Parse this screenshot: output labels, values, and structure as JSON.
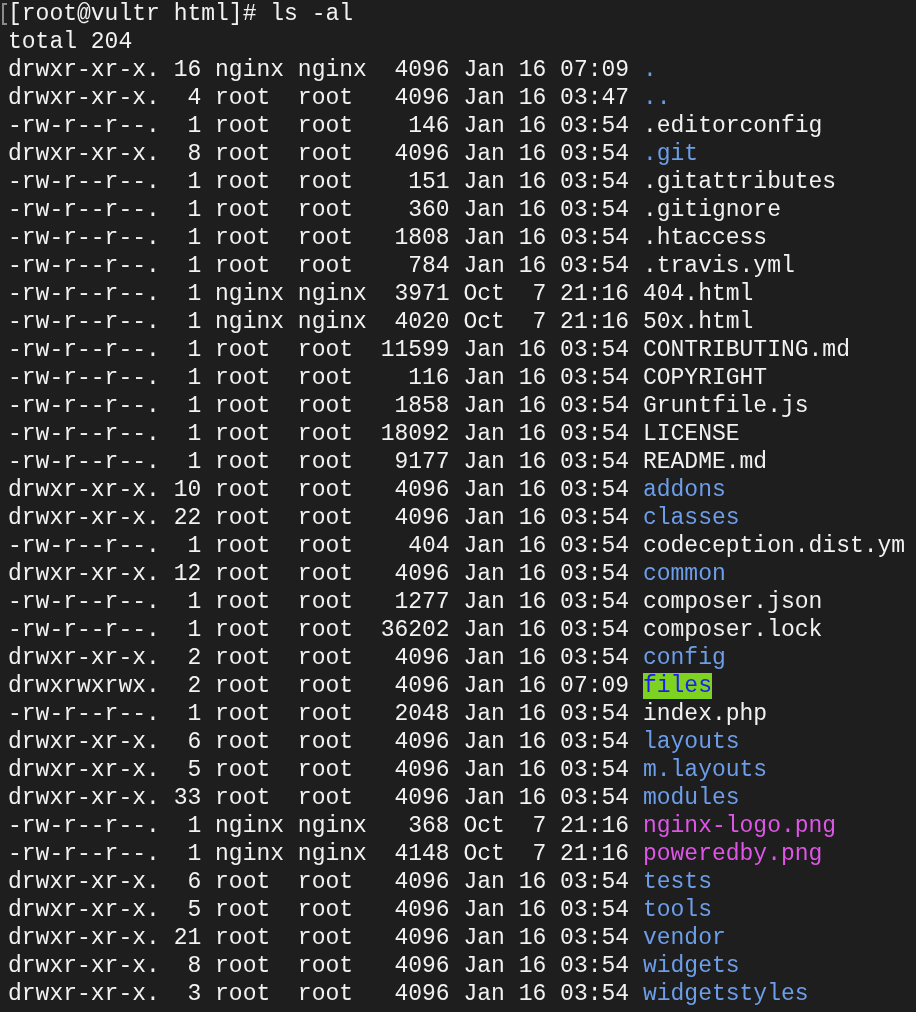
{
  "prompt": "[root@vultr html]# ls -al",
  "total": "total 204",
  "rows": [
    {
      "perms": "drwxr-xr-x.",
      "links": "16",
      "owner": "nginx",
      "group": "nginx",
      "size": "4096",
      "month": "Jan",
      "day": "16",
      "time": "07:09",
      "name": ".",
      "kind": "dir"
    },
    {
      "perms": "drwxr-xr-x.",
      "links": "4",
      "owner": "root",
      "group": "root",
      "size": "4096",
      "month": "Jan",
      "day": "16",
      "time": "03:47",
      "name": "..",
      "kind": "dir"
    },
    {
      "perms": "-rw-r--r--.",
      "links": "1",
      "owner": "root",
      "group": "root",
      "size": "146",
      "month": "Jan",
      "day": "16",
      "time": "03:54",
      "name": ".editorconfig",
      "kind": "file"
    },
    {
      "perms": "drwxr-xr-x.",
      "links": "8",
      "owner": "root",
      "group": "root",
      "size": "4096",
      "month": "Jan",
      "day": "16",
      "time": "03:54",
      "name": ".git",
      "kind": "dir"
    },
    {
      "perms": "-rw-r--r--.",
      "links": "1",
      "owner": "root",
      "group": "root",
      "size": "151",
      "month": "Jan",
      "day": "16",
      "time": "03:54",
      "name": ".gitattributes",
      "kind": "file"
    },
    {
      "perms": "-rw-r--r--.",
      "links": "1",
      "owner": "root",
      "group": "root",
      "size": "360",
      "month": "Jan",
      "day": "16",
      "time": "03:54",
      "name": ".gitignore",
      "kind": "file"
    },
    {
      "perms": "-rw-r--r--.",
      "links": "1",
      "owner": "root",
      "group": "root",
      "size": "1808",
      "month": "Jan",
      "day": "16",
      "time": "03:54",
      "name": ".htaccess",
      "kind": "file"
    },
    {
      "perms": "-rw-r--r--.",
      "links": "1",
      "owner": "root",
      "group": "root",
      "size": "784",
      "month": "Jan",
      "day": "16",
      "time": "03:54",
      "name": ".travis.yml",
      "kind": "file"
    },
    {
      "perms": "-rw-r--r--.",
      "links": "1",
      "owner": "nginx",
      "group": "nginx",
      "size": "3971",
      "month": "Oct",
      "day": "7",
      "time": "21:16",
      "name": "404.html",
      "kind": "file"
    },
    {
      "perms": "-rw-r--r--.",
      "links": "1",
      "owner": "nginx",
      "group": "nginx",
      "size": "4020",
      "month": "Oct",
      "day": "7",
      "time": "21:16",
      "name": "50x.html",
      "kind": "file"
    },
    {
      "perms": "-rw-r--r--.",
      "links": "1",
      "owner": "root",
      "group": "root",
      "size": "11599",
      "month": "Jan",
      "day": "16",
      "time": "03:54",
      "name": "CONTRIBUTING.md",
      "kind": "file"
    },
    {
      "perms": "-rw-r--r--.",
      "links": "1",
      "owner": "root",
      "group": "root",
      "size": "116",
      "month": "Jan",
      "day": "16",
      "time": "03:54",
      "name": "COPYRIGHT",
      "kind": "file"
    },
    {
      "perms": "-rw-r--r--.",
      "links": "1",
      "owner": "root",
      "group": "root",
      "size": "1858",
      "month": "Jan",
      "day": "16",
      "time": "03:54",
      "name": "Gruntfile.js",
      "kind": "file"
    },
    {
      "perms": "-rw-r--r--.",
      "links": "1",
      "owner": "root",
      "group": "root",
      "size": "18092",
      "month": "Jan",
      "day": "16",
      "time": "03:54",
      "name": "LICENSE",
      "kind": "file"
    },
    {
      "perms": "-rw-r--r--.",
      "links": "1",
      "owner": "root",
      "group": "root",
      "size": "9177",
      "month": "Jan",
      "day": "16",
      "time": "03:54",
      "name": "README.md",
      "kind": "file"
    },
    {
      "perms": "drwxr-xr-x.",
      "links": "10",
      "owner": "root",
      "group": "root",
      "size": "4096",
      "month": "Jan",
      "day": "16",
      "time": "03:54",
      "name": "addons",
      "kind": "dir"
    },
    {
      "perms": "drwxr-xr-x.",
      "links": "22",
      "owner": "root",
      "group": "root",
      "size": "4096",
      "month": "Jan",
      "day": "16",
      "time": "03:54",
      "name": "classes",
      "kind": "dir"
    },
    {
      "perms": "-rw-r--r--.",
      "links": "1",
      "owner": "root",
      "group": "root",
      "size": "404",
      "month": "Jan",
      "day": "16",
      "time": "03:54",
      "name": "codeception.dist.ym",
      "kind": "file"
    },
    {
      "perms": "drwxr-xr-x.",
      "links": "12",
      "owner": "root",
      "group": "root",
      "size": "4096",
      "month": "Jan",
      "day": "16",
      "time": "03:54",
      "name": "common",
      "kind": "dir"
    },
    {
      "perms": "-rw-r--r--.",
      "links": "1",
      "owner": "root",
      "group": "root",
      "size": "1277",
      "month": "Jan",
      "day": "16",
      "time": "03:54",
      "name": "composer.json",
      "kind": "file"
    },
    {
      "perms": "-rw-r--r--.",
      "links": "1",
      "owner": "root",
      "group": "root",
      "size": "36202",
      "month": "Jan",
      "day": "16",
      "time": "03:54",
      "name": "composer.lock",
      "kind": "file"
    },
    {
      "perms": "drwxr-xr-x.",
      "links": "2",
      "owner": "root",
      "group": "root",
      "size": "4096",
      "month": "Jan",
      "day": "16",
      "time": "03:54",
      "name": "config",
      "kind": "dir"
    },
    {
      "perms": "drwxrwxrwx.",
      "links": "2",
      "owner": "root",
      "group": "root",
      "size": "4096",
      "month": "Jan",
      "day": "16",
      "time": "07:09",
      "name": "files",
      "kind": "writable"
    },
    {
      "perms": "-rw-r--r--.",
      "links": "1",
      "owner": "root",
      "group": "root",
      "size": "2048",
      "month": "Jan",
      "day": "16",
      "time": "03:54",
      "name": "index.php",
      "kind": "file"
    },
    {
      "perms": "drwxr-xr-x.",
      "links": "6",
      "owner": "root",
      "group": "root",
      "size": "4096",
      "month": "Jan",
      "day": "16",
      "time": "03:54",
      "name": "layouts",
      "kind": "dir"
    },
    {
      "perms": "drwxr-xr-x.",
      "links": "5",
      "owner": "root",
      "group": "root",
      "size": "4096",
      "month": "Jan",
      "day": "16",
      "time": "03:54",
      "name": "m.layouts",
      "kind": "dir"
    },
    {
      "perms": "drwxr-xr-x.",
      "links": "33",
      "owner": "root",
      "group": "root",
      "size": "4096",
      "month": "Jan",
      "day": "16",
      "time": "03:54",
      "name": "modules",
      "kind": "dir"
    },
    {
      "perms": "-rw-r--r--.",
      "links": "1",
      "owner": "nginx",
      "group": "nginx",
      "size": "368",
      "month": "Oct",
      "day": "7",
      "time": "21:16",
      "name": "nginx-logo.png",
      "kind": "image"
    },
    {
      "perms": "-rw-r--r--.",
      "links": "1",
      "owner": "nginx",
      "group": "nginx",
      "size": "4148",
      "month": "Oct",
      "day": "7",
      "time": "21:16",
      "name": "poweredby.png",
      "kind": "image"
    },
    {
      "perms": "drwxr-xr-x.",
      "links": "6",
      "owner": "root",
      "group": "root",
      "size": "4096",
      "month": "Jan",
      "day": "16",
      "time": "03:54",
      "name": "tests",
      "kind": "dir"
    },
    {
      "perms": "drwxr-xr-x.",
      "links": "5",
      "owner": "root",
      "group": "root",
      "size": "4096",
      "month": "Jan",
      "day": "16",
      "time": "03:54",
      "name": "tools",
      "kind": "dir"
    },
    {
      "perms": "drwxr-xr-x.",
      "links": "21",
      "owner": "root",
      "group": "root",
      "size": "4096",
      "month": "Jan",
      "day": "16",
      "time": "03:54",
      "name": "vendor",
      "kind": "dir"
    },
    {
      "perms": "drwxr-xr-x.",
      "links": "8",
      "owner": "root",
      "group": "root",
      "size": "4096",
      "month": "Jan",
      "day": "16",
      "time": "03:54",
      "name": "widgets",
      "kind": "dir"
    },
    {
      "perms": "drwxr-xr-x.",
      "links": "3",
      "owner": "root",
      "group": "root",
      "size": "4096",
      "month": "Jan",
      "day": "16",
      "time": "03:54",
      "name": "widgetstyles",
      "kind": "dir"
    }
  ]
}
